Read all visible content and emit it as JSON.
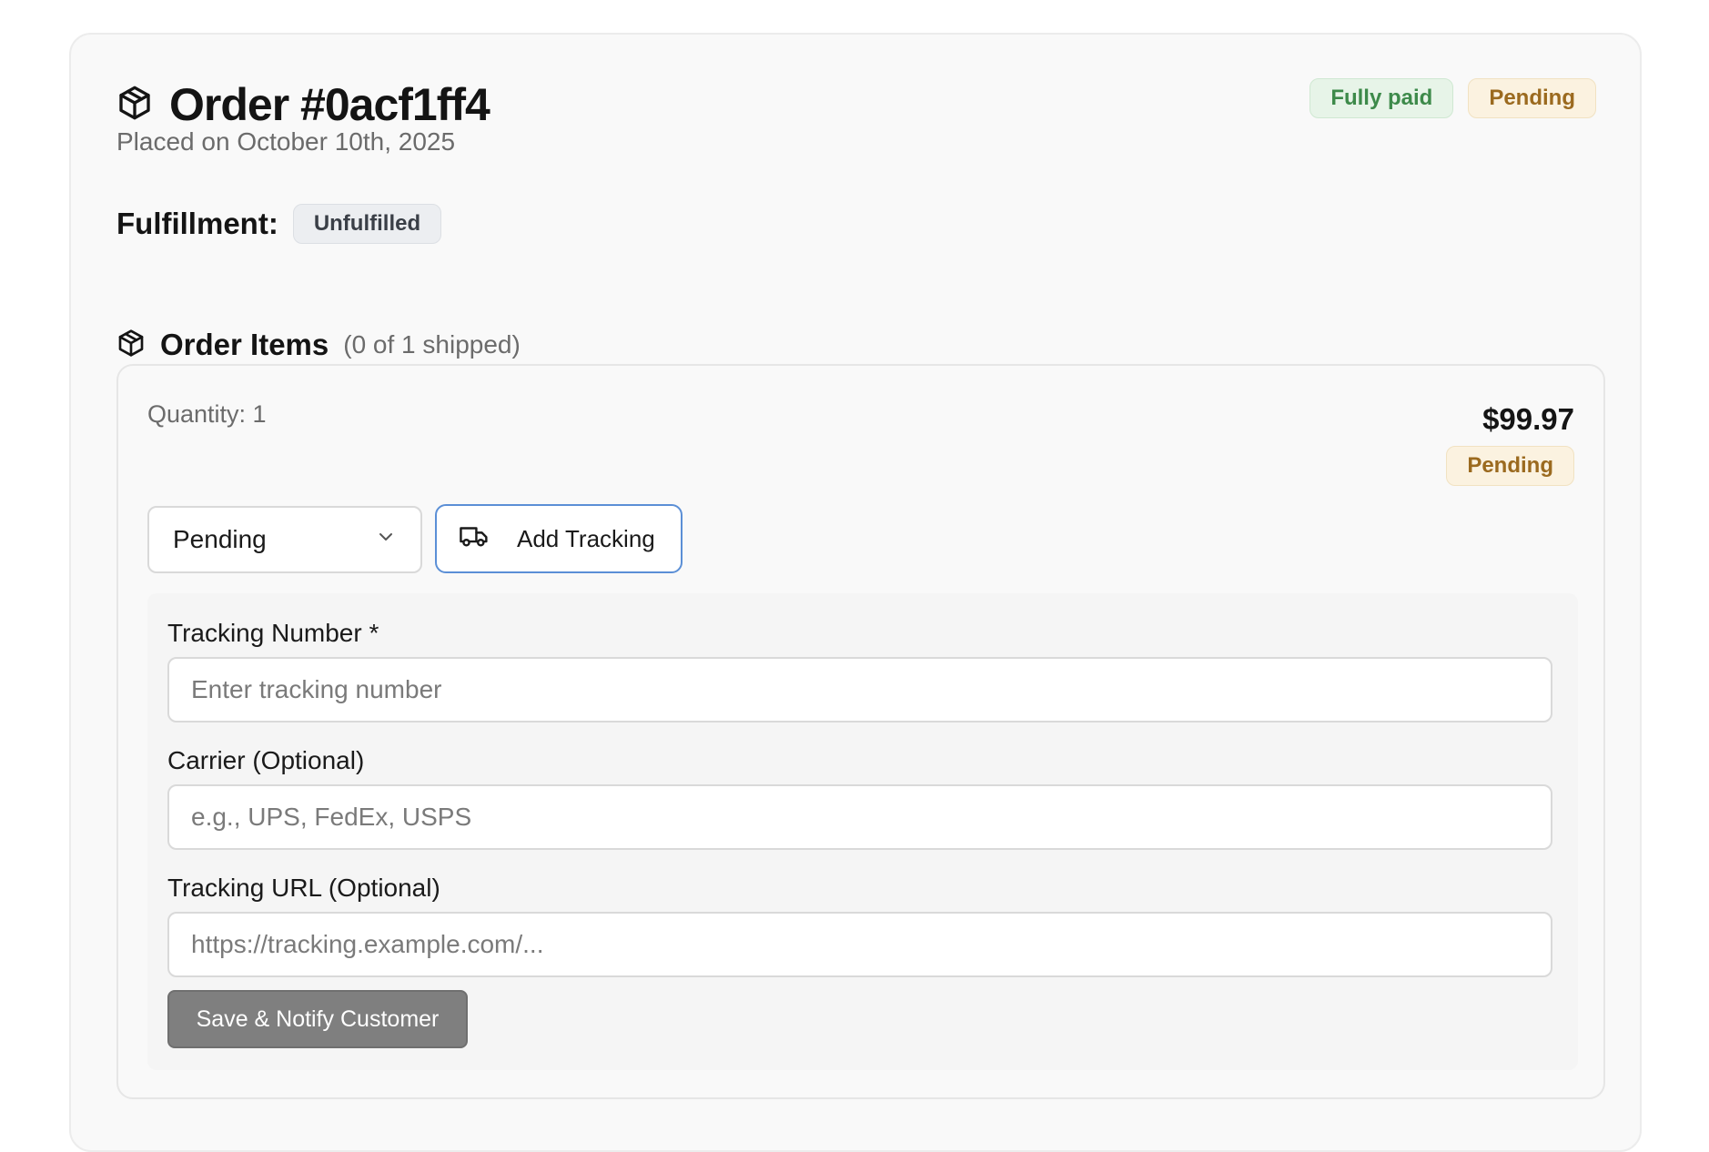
{
  "order": {
    "title": "Order #0acf1ff4",
    "placed": "Placed on October 10th, 2025",
    "payment_badge": "Fully paid",
    "status_badge": "Pending"
  },
  "fulfillment": {
    "label": "Fulfillment:",
    "status": "Unfulfilled"
  },
  "items": {
    "title": "Order Items",
    "shipped_summary": "(0 of 1 shipped)",
    "item": {
      "quantity": "Quantity: 1",
      "price": "$99.97",
      "status_badge": "Pending",
      "status_select_value": "Pending",
      "add_tracking_label": "Add Tracking"
    }
  },
  "tracking_form": {
    "tracking_number_label": "Tracking Number *",
    "tracking_number_placeholder": "Enter tracking number",
    "carrier_label": "Carrier (Optional)",
    "carrier_placeholder": "e.g., UPS, FedEx, USPS",
    "url_label": "Tracking URL (Optional)",
    "url_placeholder": "https://tracking.example.com/...",
    "save_label": "Save & Notify Customer"
  },
  "colors": {
    "paid_badge": "#3d8a4a",
    "pending_badge": "#9b6a1f",
    "add_tracking_border": "#5b8fd6",
    "save_button": "#7f7f7f"
  },
  "icons": {
    "order": "package-icon",
    "items": "package-icon",
    "select": "chevron-down-icon",
    "add_tracking": "truck-icon"
  }
}
